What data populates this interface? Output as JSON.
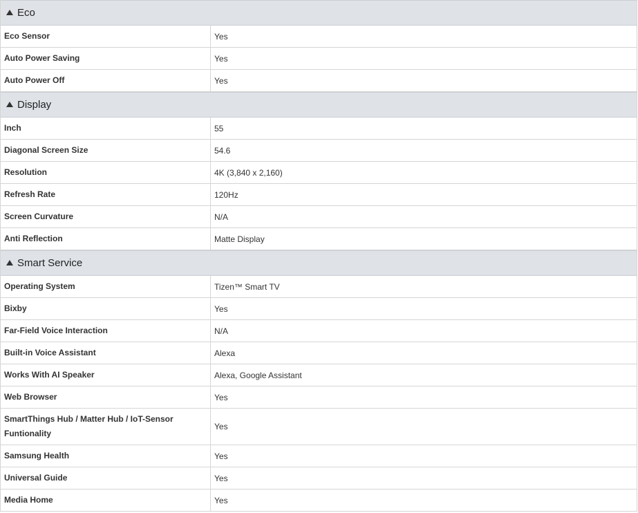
{
  "sections": [
    {
      "title": "Eco",
      "rows": [
        {
          "label": "Eco Sensor",
          "value": "Yes"
        },
        {
          "label": "Auto Power Saving",
          "value": "Yes"
        },
        {
          "label": "Auto Power Off",
          "value": "Yes"
        }
      ]
    },
    {
      "title": "Display",
      "rows": [
        {
          "label": "Inch",
          "value": "55"
        },
        {
          "label": "Diagonal Screen Size",
          "value": "54.6"
        },
        {
          "label": "Resolution",
          "value": "4K (3,840 x 2,160)"
        },
        {
          "label": "Refresh Rate",
          "value": "120Hz"
        },
        {
          "label": "Screen Curvature",
          "value": "N/A"
        },
        {
          "label": "Anti Reflection",
          "value": "Matte Display"
        }
      ]
    },
    {
      "title": "Smart Service",
      "rows": [
        {
          "label": "Operating System",
          "value": "Tizen™ Smart TV"
        },
        {
          "label": "Bixby",
          "value": "Yes"
        },
        {
          "label": "Far-Field Voice Interaction",
          "value": "N/A"
        },
        {
          "label": "Built-in Voice Assistant",
          "value": "Alexa"
        },
        {
          "label": "Works With AI Speaker",
          "value": "Alexa, Google Assistant"
        },
        {
          "label": "Web Browser",
          "value": "Yes"
        },
        {
          "label": "SmartThings Hub / Matter Hub / IoT-Sensor Funtionality",
          "value": "Yes"
        },
        {
          "label": "Samsung Health",
          "value": "Yes"
        },
        {
          "label": "Universal Guide",
          "value": "Yes"
        },
        {
          "label": "Media Home",
          "value": "Yes"
        }
      ]
    }
  ]
}
